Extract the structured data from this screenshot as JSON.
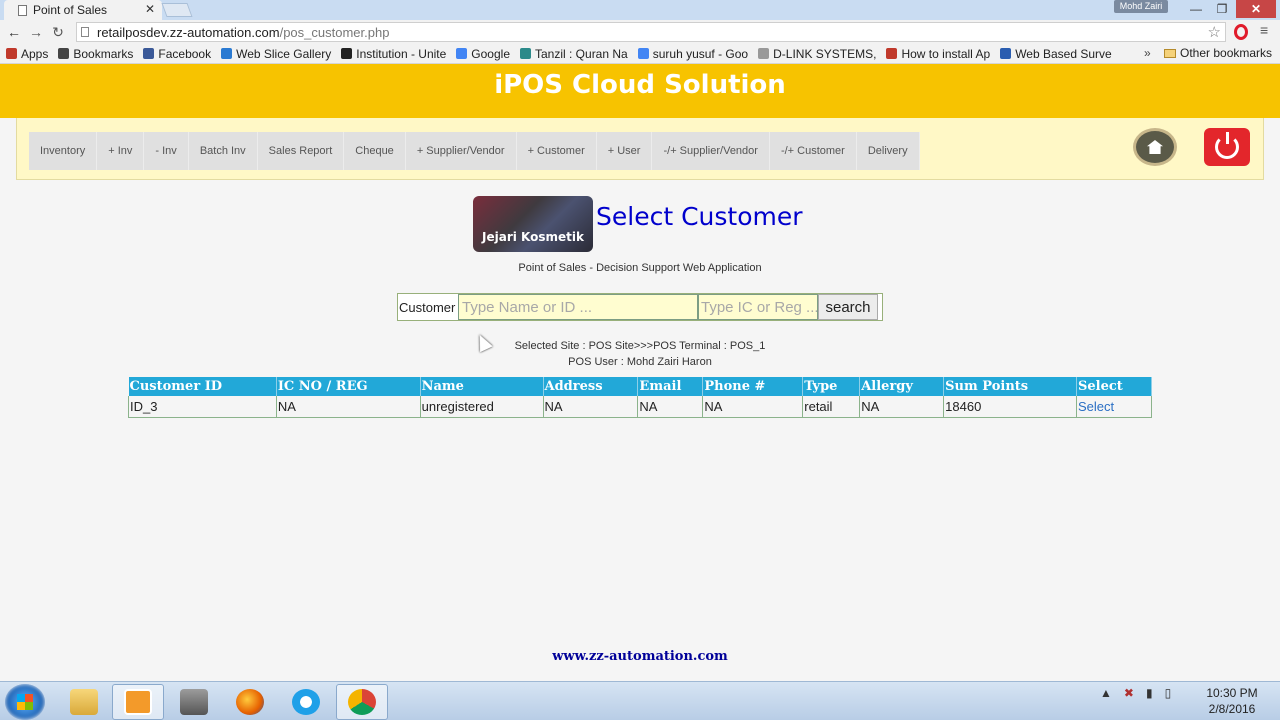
{
  "browser": {
    "tab_title": "Point of Sales",
    "profile_name": "Mohd Zairi",
    "url_host": "retailposdev.zz-automation.com",
    "url_path": "/pos_customer.php",
    "bookmarks": [
      {
        "label": "Apps",
        "icon": "apps-grid-icon",
        "color": "#c0392b"
      },
      {
        "label": "Bookmarks",
        "icon": "star-icon",
        "color": "#444444"
      },
      {
        "label": "Facebook",
        "icon": "facebook-icon",
        "color": "#3b5998"
      },
      {
        "label": "Web Slice Gallery",
        "icon": "ie-icon",
        "color": "#2a7ad2"
      },
      {
        "label": "Institution - Unite",
        "icon": "graduation-cap-icon",
        "color": "#222222"
      },
      {
        "label": "Google",
        "icon": "google-icon",
        "color": "#4285f4"
      },
      {
        "label": "Tanzil : Quran Na",
        "icon": "tanzil-icon",
        "color": "#2b8a8a"
      },
      {
        "label": "suruh yusuf - Goo",
        "icon": "google-search-icon",
        "color": "#4285f4"
      },
      {
        "label": "D-LINK SYSTEMS,",
        "icon": "page-icon",
        "color": "#999999"
      },
      {
        "label": "How to install Ap",
        "icon": "bookmark-page-icon",
        "color": "#c0392b"
      },
      {
        "label": "Web Based Surve",
        "icon": "survey-icon",
        "color": "#2a5db0"
      }
    ],
    "more_label": "»",
    "other_bookmarks": "Other bookmarks"
  },
  "page": {
    "header_title": "iPOS Cloud Solution",
    "menu": [
      "Inventory",
      "+ Inv",
      "- Inv",
      "Batch Inv",
      "Sales Report",
      "Cheque",
      "+ Supplier/Vendor",
      "+ Customer",
      "+ User",
      "-/+ Supplier/Vendor",
      "-/+ Customer",
      "Delivery"
    ],
    "brand_label": "Jejari Kosmetik",
    "title": "Select Customer",
    "subtitle": "Point of Sales - Decision Support Web Application",
    "search": {
      "label": "Customer",
      "name_placeholder": "Type Name or ID ...",
      "ic_placeholder": "Type IC or Reg ...",
      "button": "search"
    },
    "selected_site": "Selected Site : POS Site>>>POS Terminal : POS_1",
    "pos_user": "POS User : Mohd Zairi Haron",
    "table": {
      "headers": [
        "Customer ID",
        "IC NO / REG",
        "Name",
        "Address",
        "Email",
        "Phone #",
        "Type",
        "Allergy",
        "Sum Points",
        "Select"
      ],
      "rows": [
        {
          "cells": [
            "ID_3",
            "NA",
            "unregistered",
            "NA",
            "NA",
            "NA",
            "retail",
            "NA",
            "18460"
          ],
          "action": "Select"
        }
      ]
    },
    "footer": "www.zz-automation.com"
  },
  "taskbar": {
    "time": "10:30 PM",
    "date": "2/8/2016"
  },
  "colors": {
    "header": "#f7c300",
    "menu_panel": "#fff8c6",
    "table_header": "#22a8d8",
    "title": "#0000cc"
  }
}
